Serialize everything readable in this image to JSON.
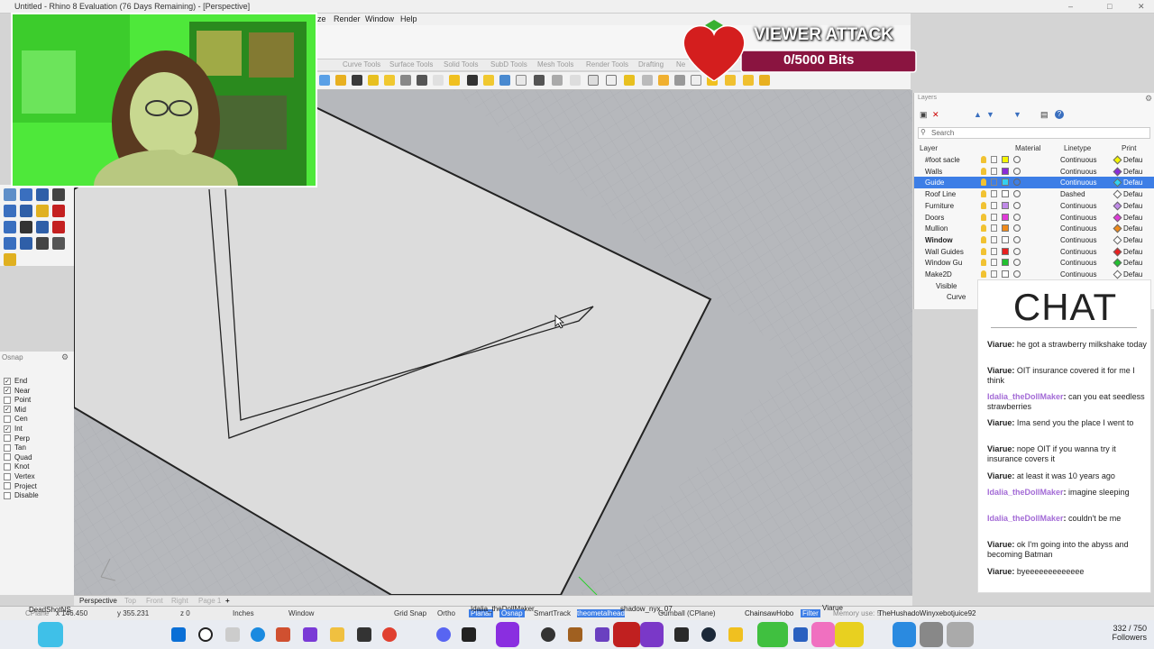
{
  "window": {
    "title": "Untitled - Rhino 8 Evaluation (76 Days Remaining) - [Perspective]"
  },
  "menu": [
    "ze",
    "Render",
    "Window",
    "Help"
  ],
  "tabs": [
    "Curve Tools",
    "Surface Tools",
    "Solid Tools",
    "SubD Tools",
    "Mesh Tools",
    "Render Tools",
    "Drafting",
    "Ne"
  ],
  "overlay": {
    "alert_title": "VIEWER ATTACK",
    "alert_progress": "0/5000 Bits",
    "chat_title": "CHAT"
  },
  "layers_panel": {
    "title": "Layers",
    "search_placeholder": "Search",
    "columns": {
      "layer": "Layer",
      "material": "Material",
      "linetype": "Linetype",
      "print": "Print"
    },
    "rows": [
      {
        "name": "#foot sacle",
        "color": "#f5f500",
        "linetype": "Continuous",
        "print": "Defau",
        "diamond": "#f5f500",
        "indent": 0
      },
      {
        "name": "Walls",
        "color": "#8b2bd9",
        "linetype": "Continuous",
        "print": "Defau",
        "diamond": "#8b2bd9",
        "indent": 0
      },
      {
        "name": "Guide",
        "color": "#33d0f0",
        "linetype": "Continuous",
        "print": "Defau",
        "diamond": "#33d0f0",
        "indent": 0,
        "selected": true
      },
      {
        "name": "Roof Line",
        "color": "#ffffff",
        "linetype": "Dashed",
        "print": "Defau",
        "diamond": "#ffffff",
        "indent": 0
      },
      {
        "name": "Furniture",
        "color": "#c08ae8",
        "linetype": "Continuous",
        "print": "Defau",
        "diamond": "#c08ae8",
        "indent": 0
      },
      {
        "name": "Doors",
        "color": "#e03bd8",
        "linetype": "Continuous",
        "print": "Defau",
        "diamond": "#e03bd8",
        "indent": 0
      },
      {
        "name": "Mullion",
        "color": "#f08a1a",
        "linetype": "Continuous",
        "print": "Defau",
        "diamond": "#f08a1a",
        "indent": 0
      },
      {
        "name": "Window",
        "color": "#ffffff",
        "linetype": "Continuous",
        "print": "Defau",
        "diamond": "#ffffff",
        "indent": 0,
        "bold": true
      },
      {
        "name": "Wall Guides",
        "color": "#e82020",
        "linetype": "Continuous",
        "print": "Defau",
        "diamond": "#e82020",
        "indent": 0
      },
      {
        "name": "Window Gu",
        "color": "#22c030",
        "linetype": "Continuous",
        "print": "Defau",
        "diamond": "#22c030",
        "indent": 0
      },
      {
        "name": "Make2D",
        "color": "#ffffff",
        "linetype": "Continuous",
        "print": "Defau",
        "diamond": "#ffffff",
        "indent": 0
      },
      {
        "name": "Visible",
        "color": "#ffffff",
        "linetype": "Continuous",
        "print": "Defau",
        "diamond": "#ffffff",
        "indent": 1
      },
      {
        "name": "Curve",
        "color": "#ffffff",
        "linetype": "Continuous",
        "print": "Defau",
        "diamond": "#ffffff",
        "indent": 2
      }
    ]
  },
  "osnap": {
    "header": "Osnap",
    "items": [
      {
        "label": "End",
        "checked": true
      },
      {
        "label": "Near",
        "checked": true
      },
      {
        "label": "Point",
        "checked": false
      },
      {
        "label": "Mid",
        "checked": true
      },
      {
        "label": "Cen",
        "checked": false
      },
      {
        "label": "Int",
        "checked": true
      },
      {
        "label": "Perp",
        "checked": false
      },
      {
        "label": "Tan",
        "checked": false
      },
      {
        "label": "Quad",
        "checked": false
      },
      {
        "label": "Knot",
        "checked": false
      },
      {
        "label": "Vertex",
        "checked": false
      },
      {
        "label": "Project",
        "checked": false
      },
      {
        "label": "Disable",
        "checked": false
      }
    ]
  },
  "chat": {
    "messages": [
      {
        "user": "Viarue",
        "text": "he got a strawberry milkshake today",
        "kind": "v"
      },
      {
        "user": "Viarue",
        "text": "OIT insurance covered it for me I think",
        "kind": "v"
      },
      {
        "user": "Idalia_theDollMaker",
        "text": "can you eat seedless strawberries",
        "kind": "d"
      },
      {
        "user": "Viarue",
        "text": "Ima send you the place I went to",
        "kind": "v"
      },
      {
        "user": "Viarue",
        "text": "nope OIT if you wanna try it insurance covers it",
        "kind": "v"
      },
      {
        "user": "Viarue",
        "text": "at least it was 10 years ago",
        "kind": "v"
      },
      {
        "user": "Idalia_theDollMaker",
        "text": "imagine sleeping",
        "kind": "d"
      },
      {
        "user": "Idalia_theDollMaker",
        "text": "couldn't be me",
        "kind": "d"
      },
      {
        "user": "Viarue",
        "text": "ok I'm going into the abyss and becoming Batman",
        "kind": "v"
      },
      {
        "user": "Viarue",
        "text": "byeeeeeeeeeeeee",
        "kind": "v"
      }
    ]
  },
  "viewtabs": [
    "Perspective",
    "Top",
    "Front",
    "Right",
    "Page 1",
    "+"
  ],
  "status": {
    "cplane": "CPlane",
    "x": "x 146.450",
    "y": "y 355.231",
    "z": "z 0",
    "units": "Inches",
    "layer": "Window",
    "grid_snap": "Grid Snap",
    "ortho": "Ortho",
    "planar": "Planar",
    "osnap": "Osnap",
    "smarttrack": "SmartTrack",
    "gumball": "Gumball (CPlane)",
    "filter": "Filter",
    "memory": "Memory use: 5",
    "ticker1": "DeadShotNS",
    "ticker2": "Idalia_theDollMaker",
    "ticker3": "theometalhead",
    "ticker4": "shadow_nyx_07",
    "ticker5": "ChainsawHobo",
    "ticker6": "Viarue",
    "ticker7": "TheHushadoWinyxebotjuice92"
  },
  "followers": {
    "count": "332 / 750",
    "label": "Followers"
  }
}
